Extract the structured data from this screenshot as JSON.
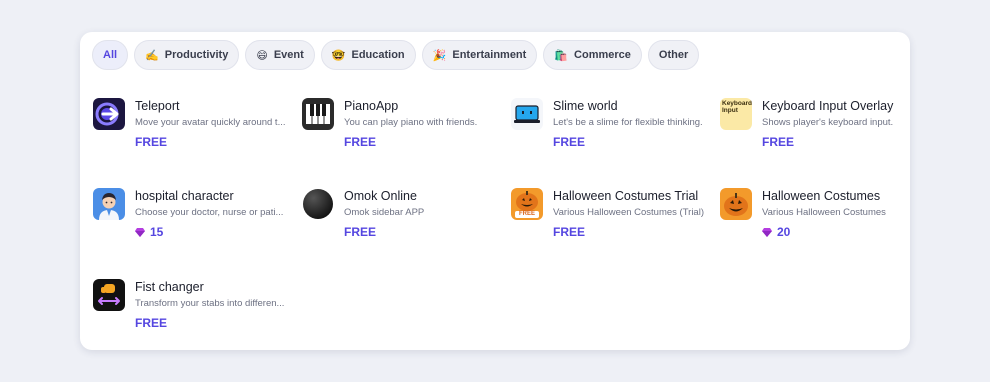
{
  "filters": [
    {
      "label": "All",
      "emoji": "",
      "active": true
    },
    {
      "label": "Productivity",
      "emoji": "✍️",
      "active": false
    },
    {
      "label": "Event",
      "emoji": "😄",
      "active": false
    },
    {
      "label": "Education",
      "emoji": "🤓",
      "active": false
    },
    {
      "label": "Entertainment",
      "emoji": "🎉",
      "active": false
    },
    {
      "label": "Commerce",
      "emoji": "🛍️",
      "active": false
    },
    {
      "label": "Other",
      "emoji": "",
      "active": false
    }
  ],
  "apps": [
    {
      "name": "Teleport",
      "desc": "Move your avatar quickly around t...",
      "price": "FREE",
      "icon": "teleport-icon"
    },
    {
      "name": "PianoApp",
      "desc": "You can play piano with friends.",
      "price": "FREE",
      "icon": "piano-icon"
    },
    {
      "name": "Slime world",
      "desc": "Let's be a slime for flexible thinking.",
      "price": "FREE",
      "icon": "slime-laptop-icon"
    },
    {
      "name": "Keyboard Input Overlay",
      "desc": "Shows player's keyboard input.",
      "price": "FREE",
      "icon": "keyboard-input-icon",
      "icon_text": "Keyboard Input"
    },
    {
      "name": "hospital character",
      "desc": "Choose your doctor, nurse or pati...",
      "price": "15",
      "gem": true,
      "icon": "doctor-avatar-icon"
    },
    {
      "name": "Omok Online",
      "desc": "Omok sidebar APP",
      "price": "FREE",
      "icon": "omok-stone-icon"
    },
    {
      "name": "Halloween Costumes Trial",
      "desc": "Various Halloween Costumes (Trial)",
      "price": "FREE",
      "icon": "pumpkin-free-icon",
      "icon_text": "FREE"
    },
    {
      "name": "Halloween Costumes",
      "desc": "Various Halloween Costumes",
      "price": "20",
      "gem": true,
      "icon": "pumpkin-icon"
    },
    {
      "name": "Fist changer",
      "desc": "Transform your stabs into differen...",
      "price": "FREE",
      "icon": "fist-swap-icon"
    }
  ],
  "colors": {
    "accent": "#5546e0",
    "gem": "#b43ee0",
    "pumpkin": "#f39a2b"
  }
}
